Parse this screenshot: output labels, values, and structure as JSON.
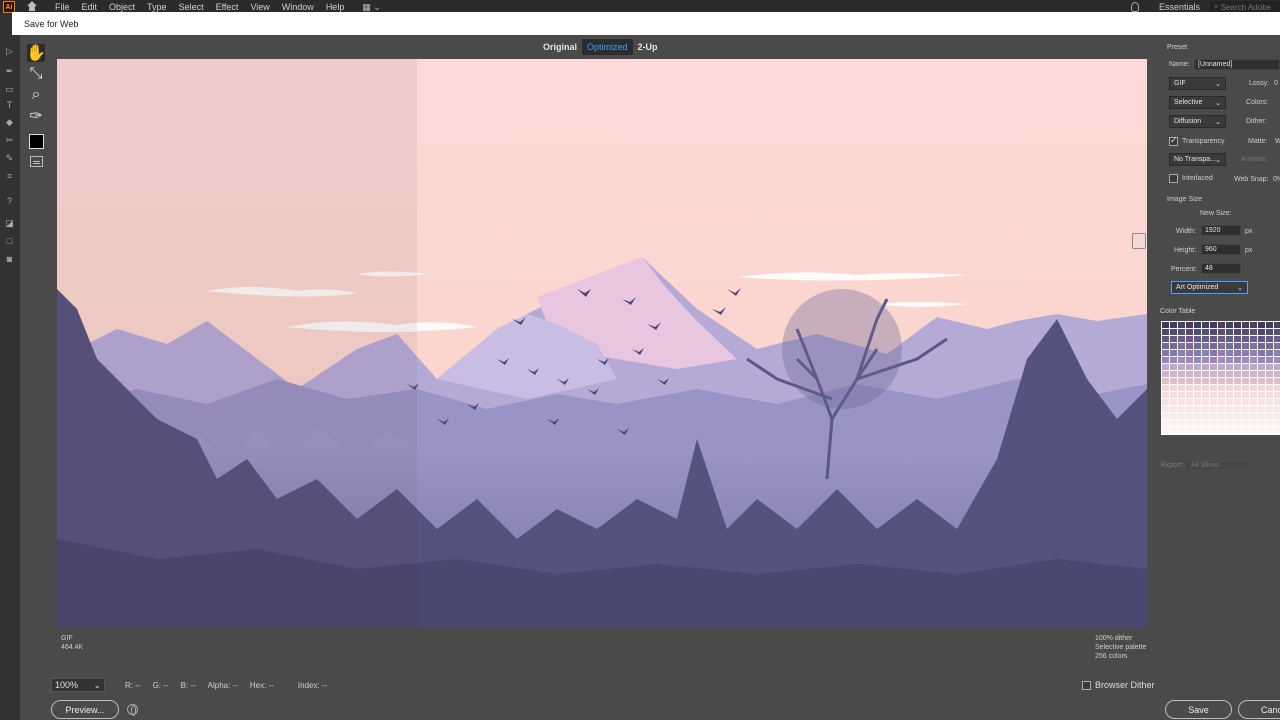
{
  "menubar": {
    "logo": "Ai",
    "items": [
      "File",
      "Edit",
      "Object",
      "Type",
      "Select",
      "Effect",
      "View",
      "Window",
      "Help"
    ],
    "workspace": "Essentials",
    "search_placeholder": "Search Adobe"
  },
  "dialog": {
    "title": "Save for Web",
    "tabs": [
      "Original",
      "Optimized",
      "2-Up"
    ],
    "selected_tab": "Optimized",
    "info_left": {
      "format": "GIF",
      "size": "464.4K"
    },
    "info_right": {
      "dither": "100% dither",
      "palette": "Selective palette",
      "colors": "256 colors"
    },
    "status": {
      "zoom": "100%",
      "r": "R: --",
      "g": "G: --",
      "b": "B: --",
      "alpha": "Alpha: --",
      "hex": "Hex: --",
      "index": "Index: --"
    },
    "browser_dither_label": "Browser Dither",
    "preview_label": "Preview...",
    "save_label": "Save",
    "cancel_label": "Cancel"
  },
  "panel": {
    "preset_heading": "Preset",
    "name_label": "Name:",
    "name_value": "[Unnamed]",
    "format": "GIF",
    "lossy_label": "Lossy:",
    "lossy_value": "0",
    "reduction": "Selective",
    "colors_label": "Colors:",
    "dither_algo": "Diffusion",
    "dither_label": "Dither:",
    "transparency_label": "Transparency",
    "matte_label": "Matte:",
    "matte_value": "W",
    "transparency_dither": "No Transpa...",
    "amount_label": "Amount:",
    "interlaced_label": "Interlaced",
    "websnap_label": "Web Snap:",
    "websnap_value": "0%",
    "image_size_heading": "Image Size",
    "new_size_label": "New Size:",
    "width_label": "Width:",
    "width_value": "1920",
    "height_label": "Height:",
    "height_value": "960",
    "unit": "px",
    "percent_label": "Percent:",
    "percent_value": "48",
    "quality": "Art Optimized",
    "color_table_heading": "Color Table",
    "export_label": "Export:",
    "export_value": "All Slices"
  },
  "colors": {
    "accent_blue": "#3ea0ff",
    "sky_top": "#fcd9d6",
    "sky_bottom": "#f8cfc9",
    "mountain_far": "#a79bd0",
    "forest_dark": "#4a4770"
  },
  "icons": [
    "ai-logo-icon",
    "home-icon",
    "workspace-switch-icon",
    "bulb-icon",
    "search-icon",
    "hand-icon",
    "slice-select-icon",
    "zoom-icon",
    "eyedropper-icon",
    "eyedropper-color-swatch",
    "toggle-slices-icon",
    "link-icon",
    "globe-icon"
  ]
}
